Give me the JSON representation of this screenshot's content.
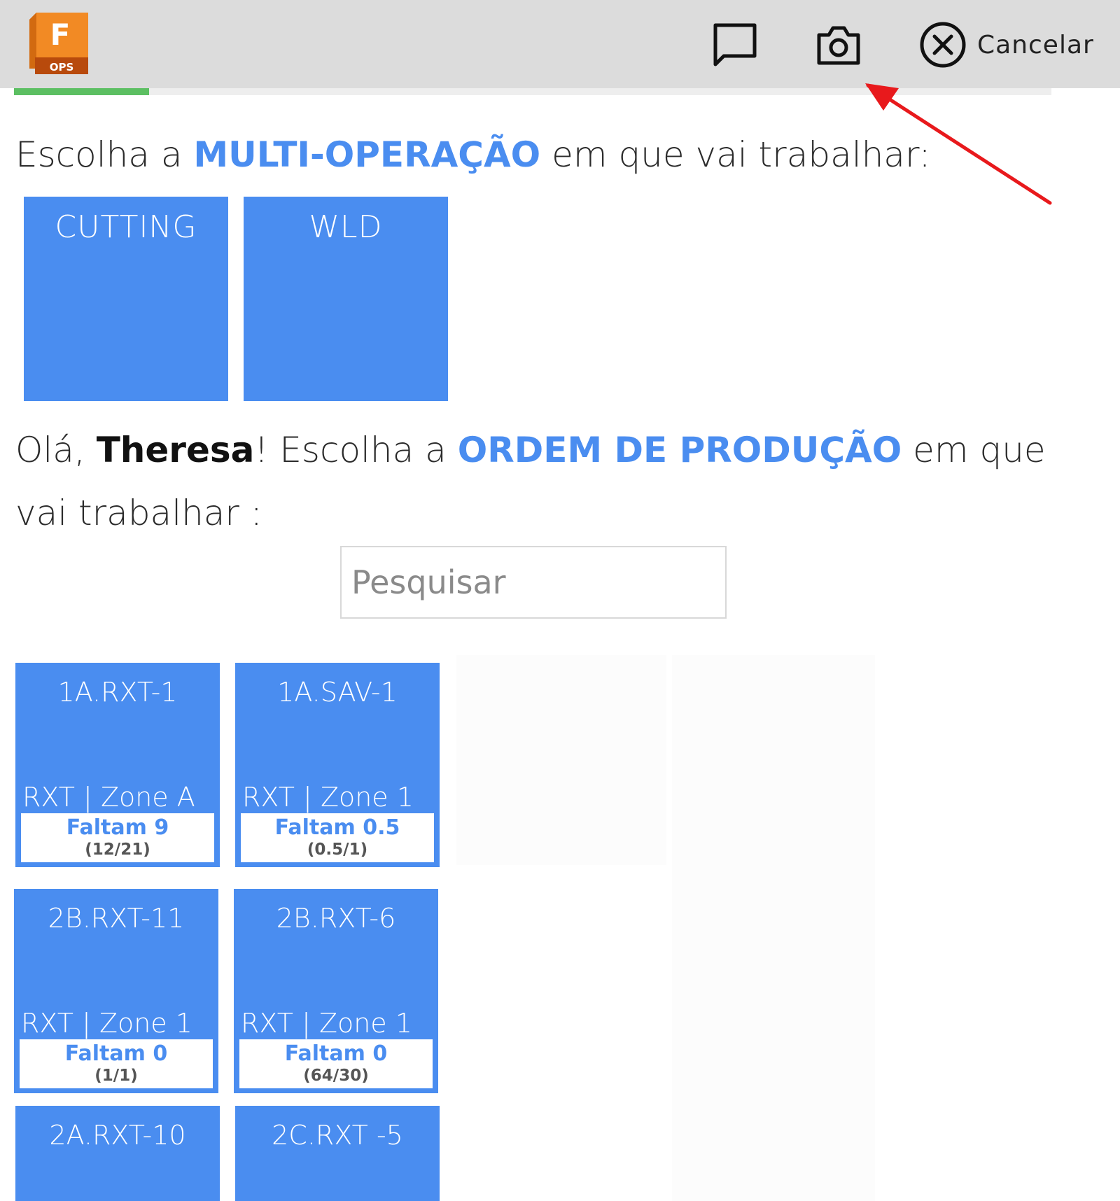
{
  "header": {
    "logo_letter": "F",
    "logo_sub": "OPS",
    "chat_icon": "chat-bubble-icon",
    "camera_icon": "camera-icon",
    "cancel_icon": "close-circle-icon",
    "cancel_label": "Cancelar",
    "progress_fraction": 0.13
  },
  "colors": {
    "accent": "#4a8df0",
    "header_bg": "#dcdcdc",
    "progress": "#5cbf62",
    "logo_orange": "#f28a24",
    "annotation_arrow": "#e8191c"
  },
  "multi_op": {
    "prefix": "Escolha a ",
    "highlight": "MULTI-OPERAÇÃO",
    "suffix": " em que vai trabalhar:",
    "tiles": [
      "CUTTING",
      "WLD"
    ]
  },
  "order": {
    "greeting": "Olá, ",
    "user": "Theresa",
    "mid": "! Escolha a ",
    "highlight": "ORDEM DE PRODUÇÃO",
    "suffix": " em que",
    "line2": "vai trabalhar :"
  },
  "search": {
    "placeholder": "Pesquisar",
    "value": ""
  },
  "orders": [
    {
      "title": "1A.RXT-1",
      "zone": "RXT | Zone A",
      "faltam": "Faltam 9",
      "count": "(12/21)"
    },
    {
      "title": "1A.SAV-1",
      "zone": "RXT | Zone 1",
      "faltam": "Faltam 0.5",
      "count": "(0.5/1)"
    },
    {
      "title": "2B.RXT-11",
      "zone": "RXT | Zone 1",
      "faltam": "Faltam 0",
      "count": "(1/1)"
    },
    {
      "title": "2B.RXT-6",
      "zone": "RXT | Zone 1",
      "faltam": "Faltam 0",
      "count": "(64/30)"
    },
    {
      "title": "2A.RXT-10"
    },
    {
      "title": "2C.RXT -5"
    }
  ]
}
